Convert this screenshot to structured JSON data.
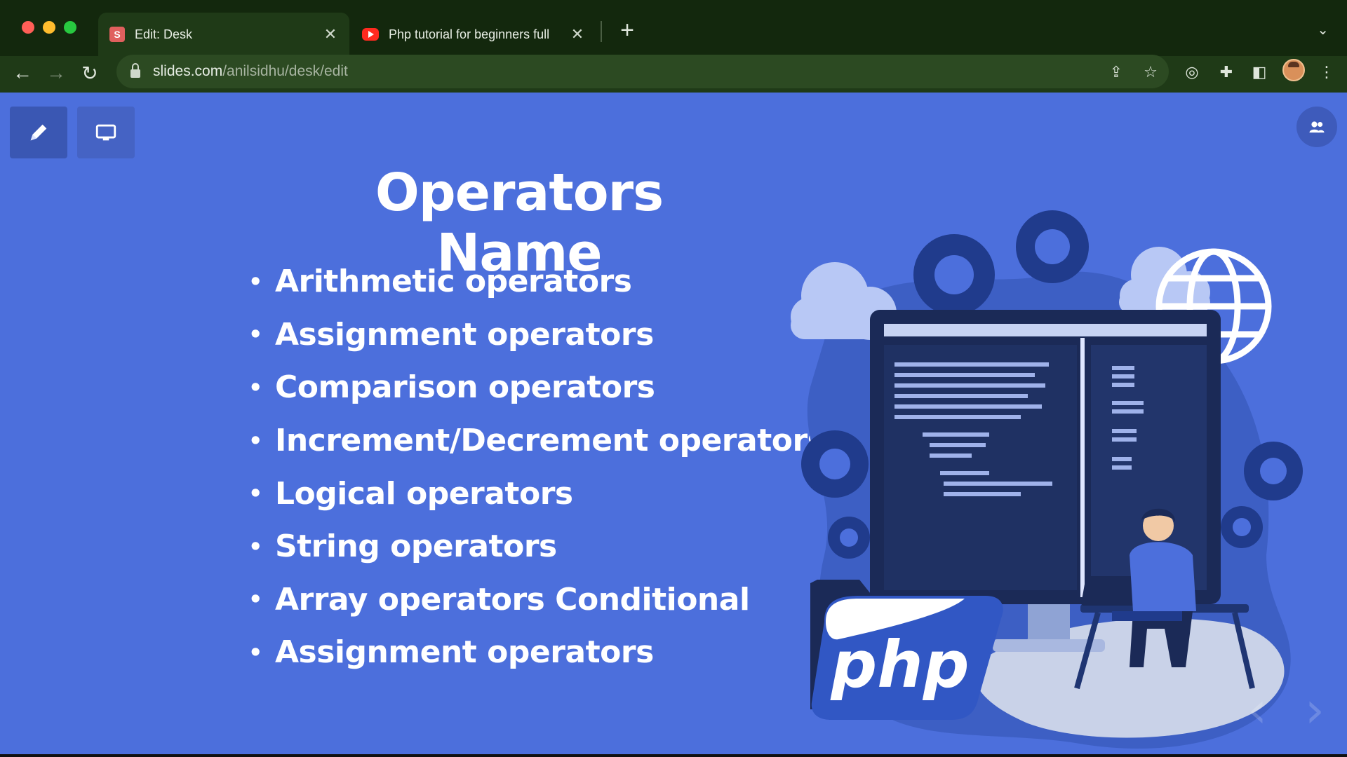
{
  "browser": {
    "tabs": [
      {
        "title": "Edit: Desk",
        "favicon": "S",
        "active": true
      },
      {
        "title": "Php tutorial for beginners full",
        "active": false
      }
    ],
    "url_host": "slides.com",
    "url_path": "/anilsidhu/desk/edit",
    "icons": {
      "back": "back-arrow-icon",
      "forward": "forward-arrow-icon",
      "reload": "reload-icon",
      "share": "share-icon",
      "bookmark": "star-icon",
      "extension1": "target-icon",
      "extensions": "puzzle-icon",
      "sidepanel": "side-panel-icon",
      "menu": "kebab-menu-icon"
    }
  },
  "slide": {
    "title": "Operators Name",
    "bullets": [
      "Arithmetic operators",
      "Assignment operators",
      "Comparison operators",
      "Increment/Decrement operators",
      "Logical operators",
      "String operators",
      "Array operators Conditional",
      "Assignment operators"
    ],
    "logo_text": "php",
    "background": "#4c6fdc"
  },
  "toolbar": {
    "edit_icon": "pencil-icon",
    "present_icon": "monitor-icon",
    "collab_icon": "people-icon"
  }
}
